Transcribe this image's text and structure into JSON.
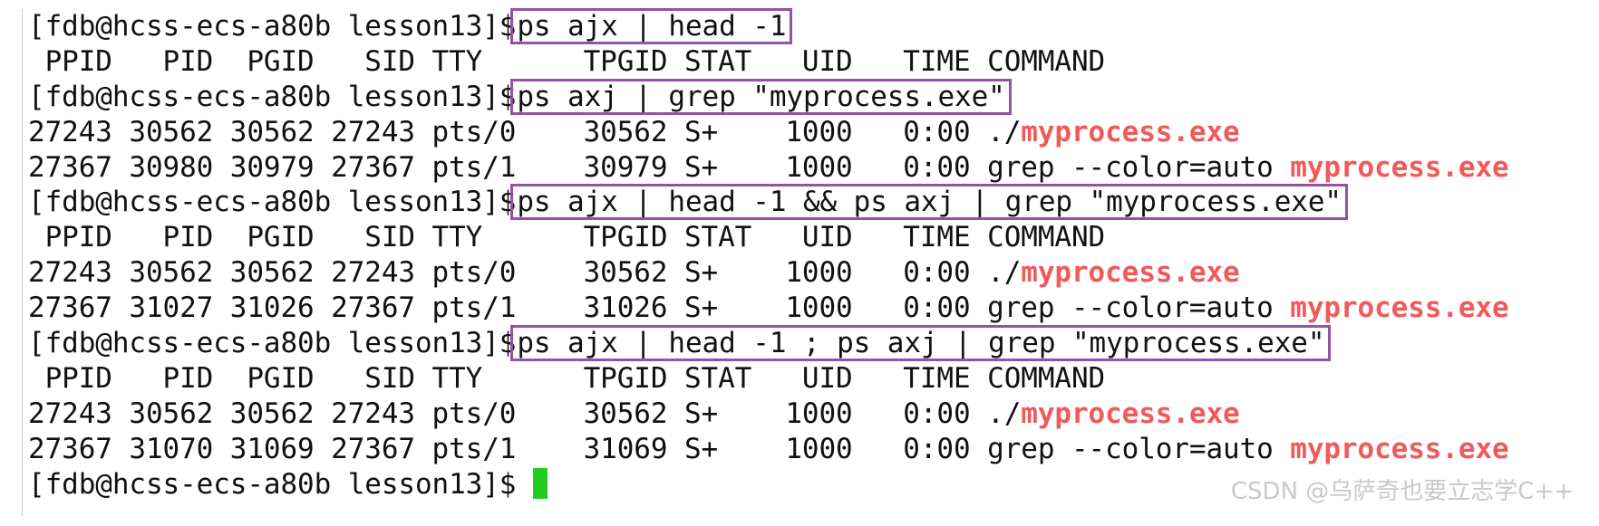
{
  "colors": {
    "background": "#ffffff",
    "text": "#111111",
    "highlight": "#f05a5a",
    "box": "#9452a5",
    "cursor": "#22cc22"
  },
  "prompt": "[fdb@hcss-ecs-a80b lesson13]$",
  "lines": [
    {
      "type": "prompt",
      "command": "ps ajx | head -1"
    },
    {
      "type": "output",
      "text": " PPID   PID  PGID   SID TTY      TPGID STAT   UID   TIME COMMAND"
    },
    {
      "type": "prompt",
      "command": "ps axj | grep \"myprocess.exe\""
    },
    {
      "type": "output",
      "prefix": "27243 30562 30562 27243 pts/0    30562 S+    1000   0:00 ./",
      "match": "myprocess.exe"
    },
    {
      "type": "output",
      "prefix": "27367 30980 30979 27367 pts/1    30979 S+    1000   0:00 grep --color=auto ",
      "match": "myprocess.exe"
    },
    {
      "type": "prompt",
      "command": "ps ajx | head -1 && ps axj | grep \"myprocess.exe\""
    },
    {
      "type": "output",
      "text": " PPID   PID  PGID   SID TTY      TPGID STAT   UID   TIME COMMAND"
    },
    {
      "type": "output",
      "prefix": "27243 30562 30562 27243 pts/0    30562 S+    1000   0:00 ./",
      "match": "myprocess.exe"
    },
    {
      "type": "output",
      "prefix": "27367 31027 31026 27367 pts/1    31026 S+    1000   0:00 grep --color=auto ",
      "match": "myprocess.exe"
    },
    {
      "type": "prompt",
      "command": "ps ajx | head -1 ; ps axj | grep \"myprocess.exe\""
    },
    {
      "type": "output",
      "text": " PPID   PID  PGID   SID TTY      TPGID STAT   UID   TIME COMMAND"
    },
    {
      "type": "output",
      "prefix": "27243 30562 30562 27243 pts/0    30562 S+    1000   0:00 ./",
      "match": "myprocess.exe"
    },
    {
      "type": "output",
      "prefix": "27367 31070 31069 27367 pts/1    31069 S+    1000   0:00 grep --color=auto ",
      "match": "myprocess.exe"
    },
    {
      "type": "input",
      "command": ""
    }
  ],
  "watermark": "CSDN @乌萨奇也要立志学C++"
}
